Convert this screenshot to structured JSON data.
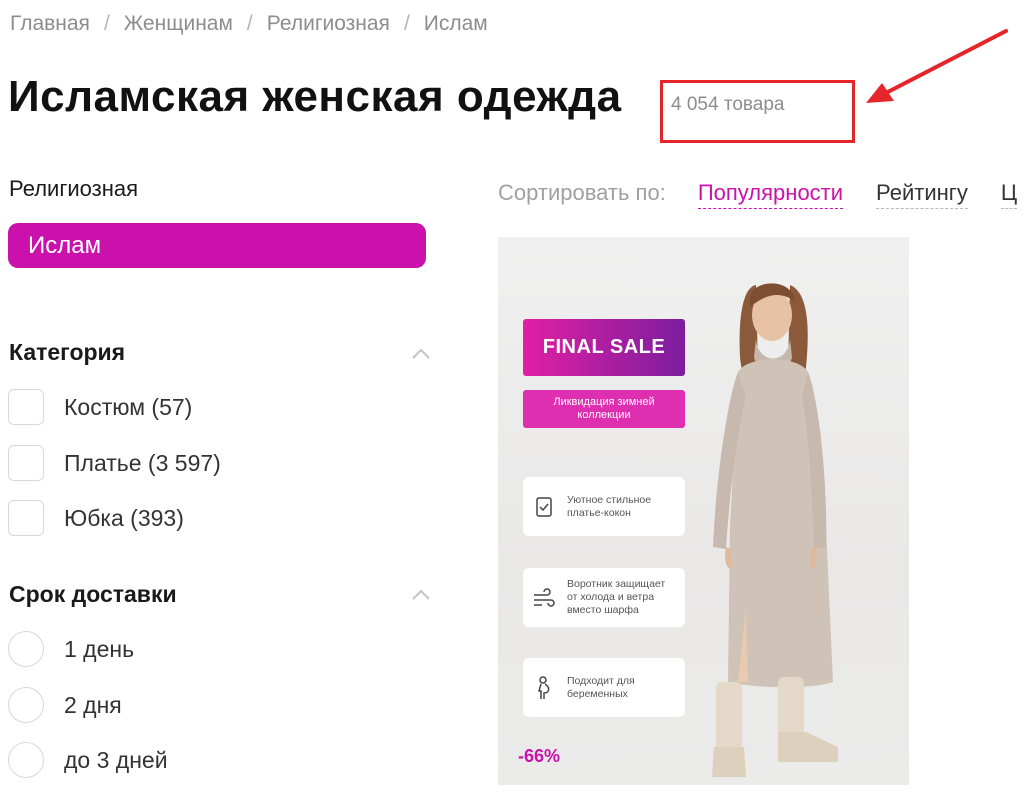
{
  "breadcrumb": {
    "items": [
      "Главная",
      "Женщинам",
      "Религиозная",
      "Ислам"
    ],
    "separator": "/"
  },
  "header": {
    "title": "Исламская женская одежда",
    "product_count": "4 054 товара"
  },
  "annotation": {
    "box_color": "#e5252a",
    "arrow_color": "#e5252a"
  },
  "filters": {
    "religious": {
      "heading": "Религиозная",
      "selected_chip": "Ислам"
    },
    "category": {
      "heading": "Категория",
      "options": [
        "Костюм (57)",
        "Платье (3 597)",
        "Юбка (393)"
      ]
    },
    "delivery": {
      "heading": "Срок доставки",
      "options": [
        "1 день",
        "2 дня",
        "до 3 дней"
      ]
    }
  },
  "sort": {
    "label": "Сортировать по:",
    "options": [
      "Популярности",
      "Рейтингу",
      "Ц"
    ],
    "active": "Популярности"
  },
  "product_card": {
    "banner_title": "FINAL SALE",
    "banner_subtitle": "Ликвидация зимней коллекции",
    "features": [
      {
        "icon": "checklist-icon",
        "text": "Уютное стильное платье-кокон"
      },
      {
        "icon": "wind-icon",
        "text": "Воротник защищает от холода и ветра вместо шарфа"
      },
      {
        "icon": "pregnancy-icon",
        "text": "Подходит для беременных"
      }
    ],
    "discount": "-66%"
  },
  "colors": {
    "accent": "#cb11ab",
    "muted_text": "#8d8d8d"
  }
}
